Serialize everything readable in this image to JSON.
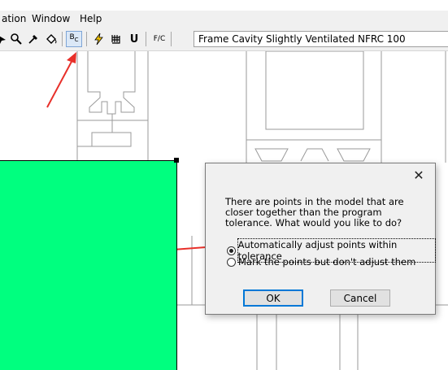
{
  "menubar": {
    "items": [
      "ation",
      "Window",
      "Help"
    ]
  },
  "toolbar": {
    "buttons": [
      "select-tool",
      "zoom-tool",
      "eyedropper-tool",
      "fill-tool",
      "boundary-conditions",
      "generate-mesh",
      "unknown-tool",
      "u-factor-tool",
      "fc-tool"
    ],
    "bc_label": "B",
    "bc_sub": "C",
    "u_label": "U",
    "fc_label": "F/C"
  },
  "combo": {
    "value": "Frame Cavity Slightly Ventilated NFRC 100"
  },
  "dialog": {
    "close": "✕",
    "message": "There are points in the model that are closer together than the program tolerance. What would you like to do?",
    "options": [
      {
        "label": "Automatically adjust points within tolerance",
        "selected": true
      },
      {
        "label": "Mark the points but don't adjust them",
        "selected": false
      }
    ],
    "ok_label": "OK",
    "cancel_label": "Cancel"
  },
  "colors": {
    "fill": "#00ff7f",
    "arrow": "#e8302a",
    "accent": "#0078d7"
  }
}
